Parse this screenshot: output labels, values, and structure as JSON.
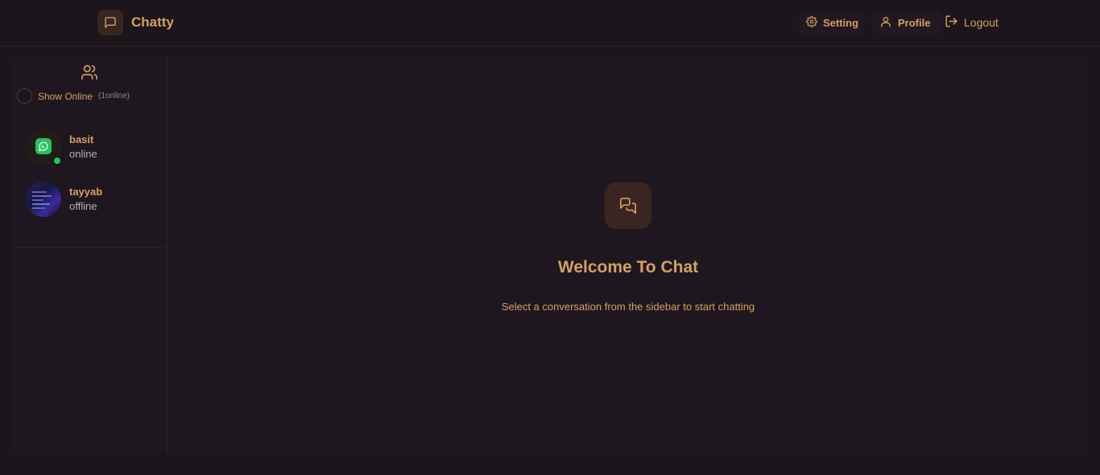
{
  "app": {
    "name": "Chatty"
  },
  "nav": {
    "setting_label": "Setting",
    "profile_label": "Profile",
    "logout_label": "Logout"
  },
  "sidebar": {
    "show_online_label": "Show Online",
    "online_count": "(1online)",
    "contacts": [
      {
        "name": "basit",
        "status": "online",
        "avatar": "whatsapp-logo"
      },
      {
        "name": "tayyab",
        "status": "offline",
        "avatar": "code-screen"
      }
    ]
  },
  "main": {
    "welcome_title": "Welcome To Chat",
    "welcome_subtitle": "Select a conversation from the sidebar to start chatting"
  },
  "colors": {
    "accent": "#d4a15f",
    "background": "#1c151c",
    "panel": "#1f171f",
    "online": "#22c55e"
  }
}
